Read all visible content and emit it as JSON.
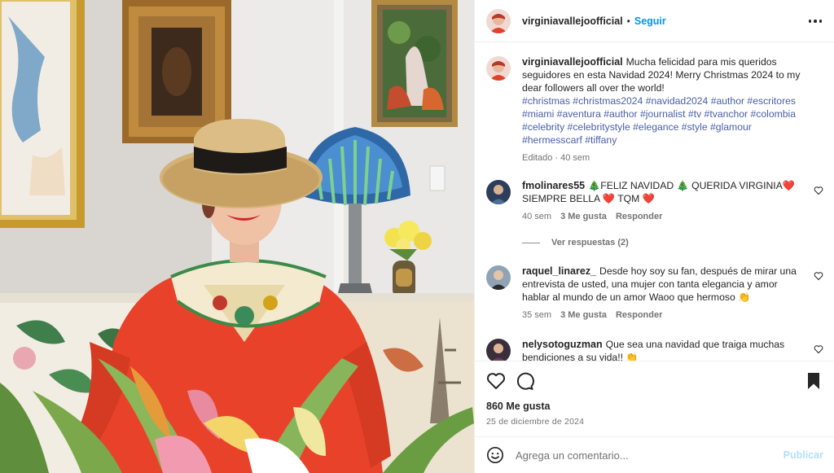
{
  "post": {
    "username": "virginiavallejoofficial",
    "follow_label": "Seguir",
    "separator": "•",
    "more_icon": "more-horizontal-icon"
  },
  "caption": {
    "username": "virginiavallejoofficial",
    "text": "Mucha felicidad para mis queridos seguidores en esta Navidad 2024! Merry Christmas 2024 to my dear followers all over the world!",
    "hashtags": "#christmas #christmas2024 #navidad2024 #author #escritores #miami #aventura #author #journalist #tv #tvanchor #colombia #celebrity #celebritystyle #elegance #style #glamour #hermesscarf #tiffany",
    "meta": "Editado · 40 sem"
  },
  "comments": [
    {
      "username": "fmolinares55",
      "text": "🎄FELIZ NAVIDAD 🎄 QUERIDA VIRGINIA❤️ SIEMPRE BELLA ❤️ TQM ❤️",
      "time": "40 sem",
      "likes": "3 Me gusta",
      "reply": "Responder"
    },
    {
      "username": "raquel_linarez_",
      "text": "Desde hoy soy su fan, después de mirar una entrevista de usted, una mujer con tanta elegancia y amor hablar al mundo de un amor Waoo que hermoso 👏",
      "time": "35 sem",
      "likes": "3 Me gusta",
      "reply": "Responder"
    },
    {
      "username": "nelysotoguzman",
      "text": "Que sea una navidad que traiga muchas bendiciones a su vida!! 👏"
    }
  ],
  "view_replies": "Ver respuestas (2)",
  "actions": {
    "like_icon": "heart-icon",
    "comment_icon": "comment-bubble-icon",
    "save_icon": "bookmark-icon",
    "likes": "860 Me gusta",
    "date": "25 de diciembre de 2024"
  },
  "composer": {
    "placeholder": "Agrega un comentario...",
    "publish_label": "Publicar",
    "emoji_icon": "emoji-smile-icon"
  },
  "colors": {
    "link_blue": "#0095f6",
    "hashtag": "#4a5fa8",
    "muted": "#737373",
    "publish_disabled": "#b2dffc"
  }
}
